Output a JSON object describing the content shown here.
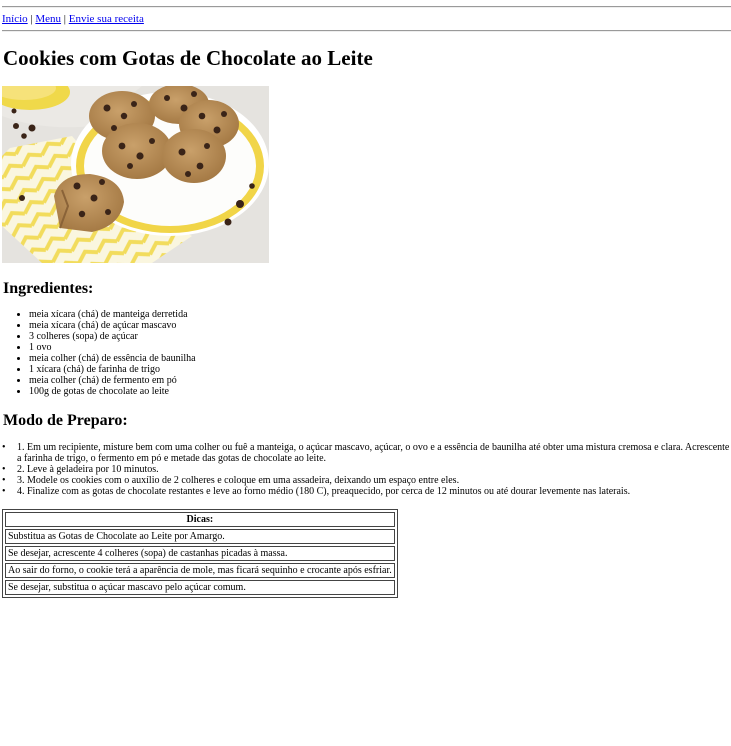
{
  "nav": {
    "home": "Início",
    "menu": "Menu",
    "submit": "Envie sua receita",
    "separator": "|"
  },
  "recipe": {
    "title": "Cookies com Gotas de Chocolate ao Leite",
    "image_icon": "cookies-photo",
    "ingredients_heading": "Ingredientes:",
    "ingredients": [
      "meia xícara (chá) de manteiga derretida",
      "meia xícara (chá) de açúcar mascavo",
      "3 colheres (sopa) de açúcar",
      "1 ovo",
      "meia colher (chá) de essência de baunilha",
      "1 xícara (chá) de farinha de trigo",
      "meia colher (chá) de fermento em pó",
      "100g de gotas de chocolate ao leite"
    ],
    "steps_heading": "Modo de Preparo:",
    "steps": [
      "1. Em um recipiente, misture bem com uma colher ou fuê a manteiga, o açúcar mascavo, açúcar, o ovo e a essência de baunilha até obter uma mistura cremosa e clara. Acrescente a farinha de trigo, o fermento em pó e metade das gotas de chocolate ao leite.",
      "2. Leve à geladeira por 10 minutos.",
      "3. Modele os cookies com o auxílio de 2 colheres e coloque em uma assadeira, deixando um espaço entre eles.",
      "4. Finalize com as gotas de chocolate restantes e leve ao forno médio (180 C), preaquecido, por cerca de 12 minutos ou até dourar levemente nas laterais."
    ],
    "tips_heading": "Dicas:",
    "tips": [
      "Substitua as Gotas de Chocolate ao Leite por Amargo.",
      "Se desejar, acrescente 4 colheres (sopa) de castanhas picadas à massa.",
      "Ao sair do forno, o cookie terá a aparência de mole, mas ficará sequinho e crocante após esfriar.",
      "Se desejar, substitua o açúcar mascavo pelo açúcar comum."
    ]
  },
  "colors": {
    "link": "#0000ee",
    "plate": "#ffffff",
    "napkin_yellow": "#f2dc5c",
    "cookie": "#b98d55",
    "chip": "#3a2418"
  }
}
